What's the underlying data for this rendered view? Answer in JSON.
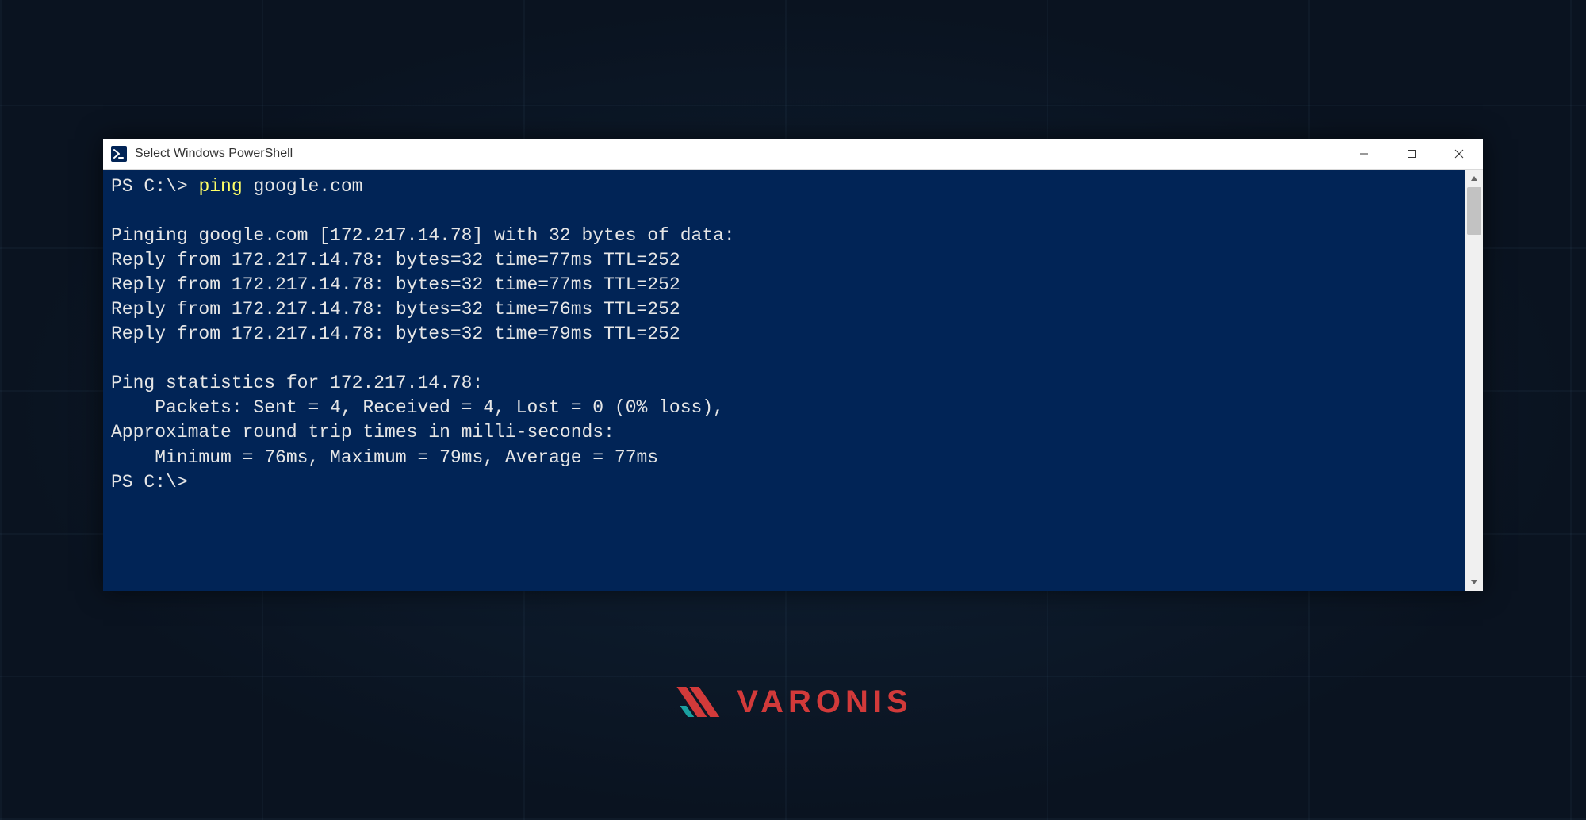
{
  "window": {
    "title": "Select Windows PowerShell",
    "icon_name": "powershell-icon"
  },
  "prompt": {
    "prefix": "PS C:\\>",
    "command_highlight": "ping",
    "command_rest": " google.com"
  },
  "output": {
    "header": "Pinging google.com [172.217.14.78] with 32 bytes of data:",
    "replies": [
      "Reply from 172.217.14.78: bytes=32 time=77ms TTL=252",
      "Reply from 172.217.14.78: bytes=32 time=77ms TTL=252",
      "Reply from 172.217.14.78: bytes=32 time=76ms TTL=252",
      "Reply from 172.217.14.78: bytes=32 time=79ms TTL=252"
    ],
    "stats_header": "Ping statistics for 172.217.14.78:",
    "stats_packets": "    Packets: Sent = 4, Received = 4, Lost = 0 (0% loss),",
    "rtt_header": "Approximate round trip times in milli-seconds:",
    "rtt_line": "    Minimum = 76ms, Maximum = 79ms, Average = 77ms",
    "final_prompt": "PS C:\\>"
  },
  "brand": {
    "name": "VARONIS",
    "logo_color_primary": "#d23a3a",
    "logo_color_accent": "#1aa0a0"
  }
}
